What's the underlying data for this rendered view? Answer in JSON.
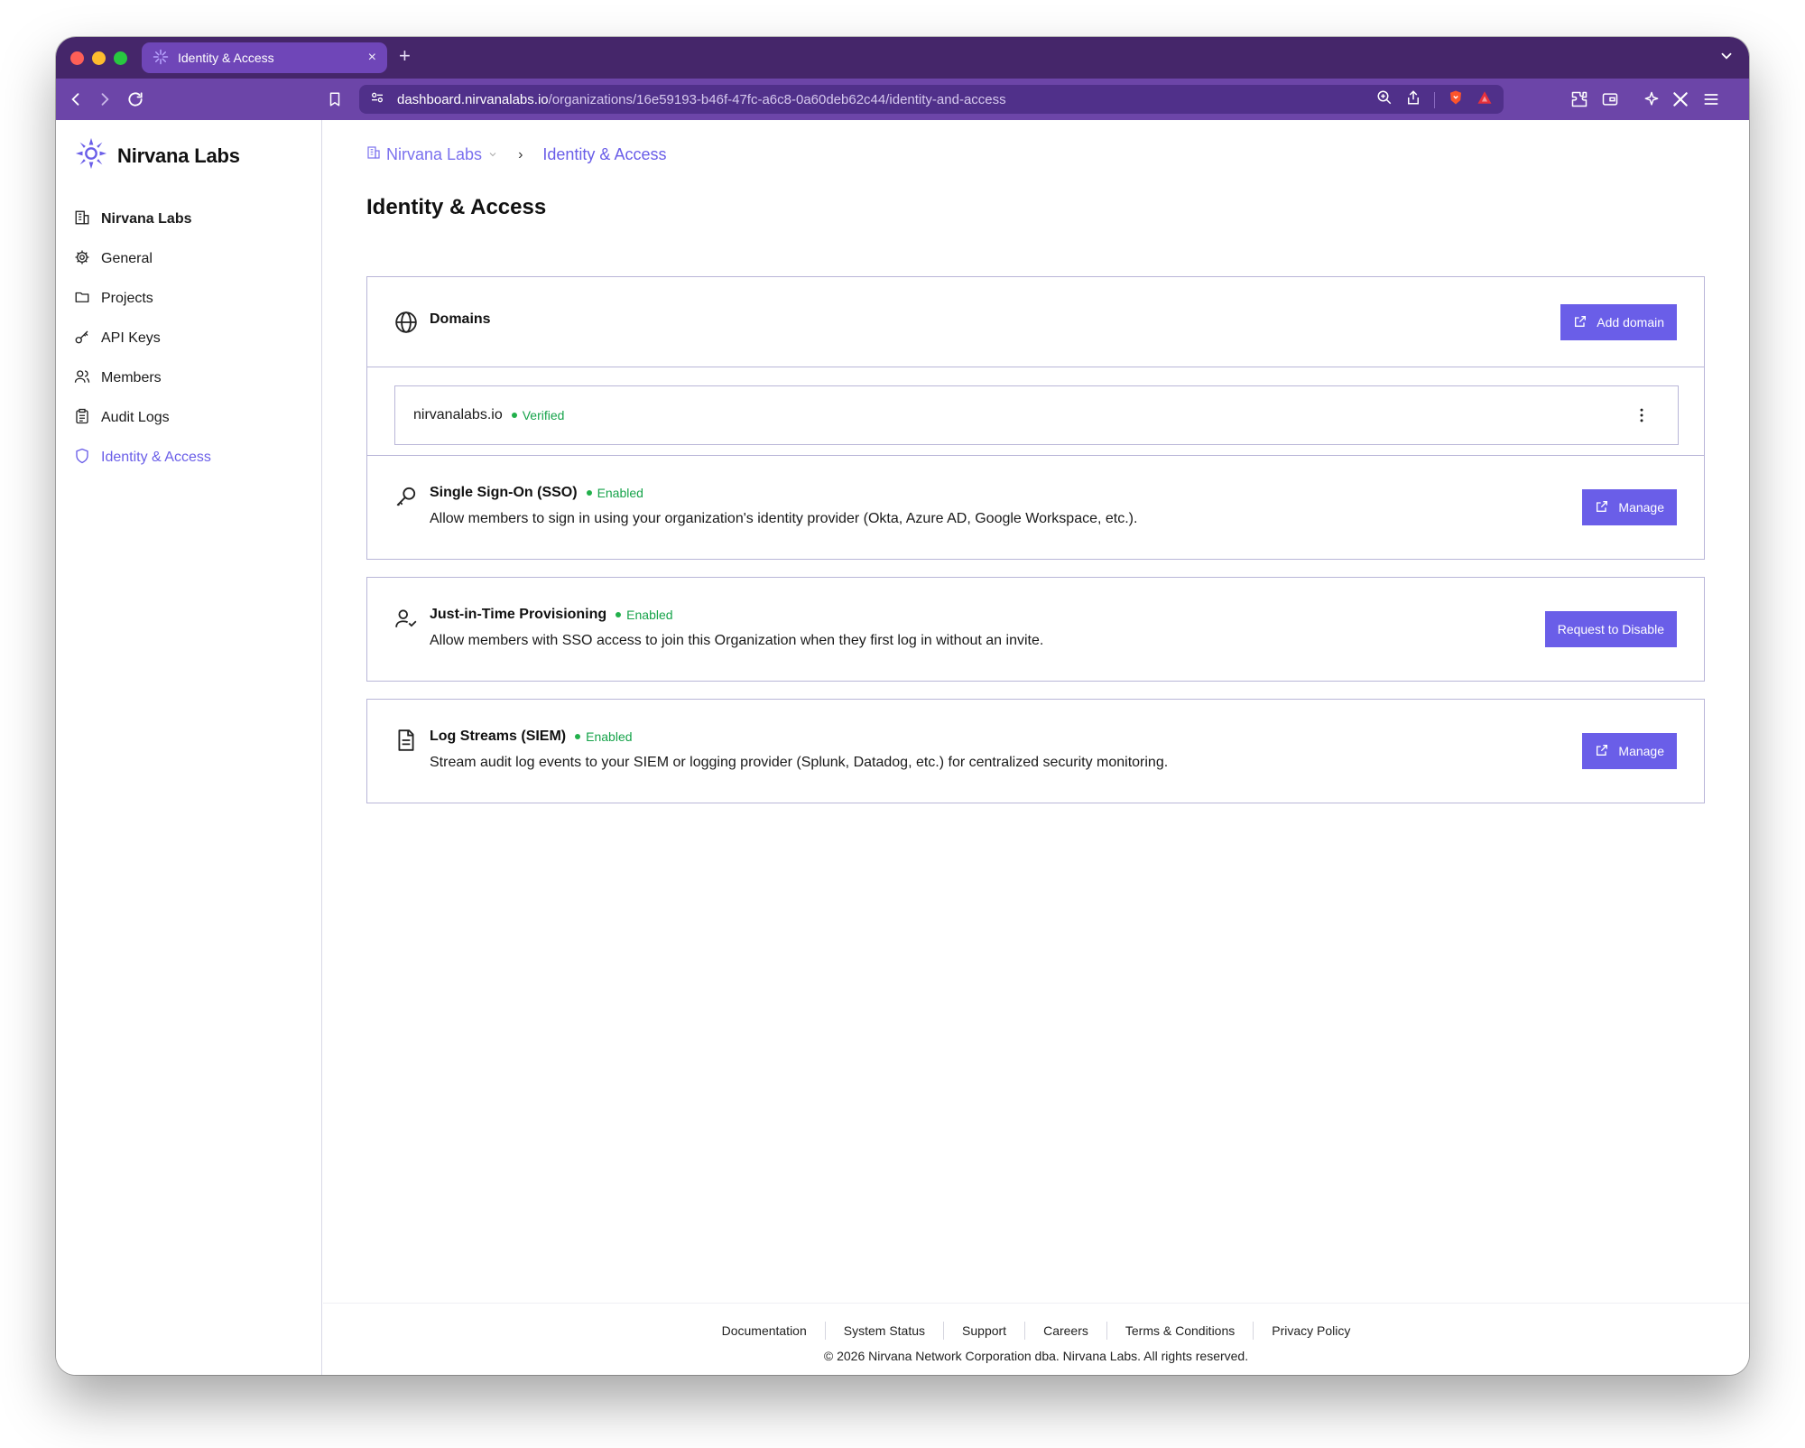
{
  "browser": {
    "tab_title": "Identity & Access",
    "tab_close": "×",
    "new_tab": "+",
    "url_host": "dashboard.nirvanalabs.io",
    "url_path": "/organizations/16e59193-b46f-47fc-a6c8-0a60deb62c44/identity-and-access",
    "colors": {
      "tabbar": "#45266a",
      "toolbar": "#6c45a8",
      "active_tab": "#6f46b8"
    }
  },
  "sidebar": {
    "brand": "Nirvana Labs",
    "items": [
      {
        "label": "Nirvana Labs",
        "icon": "building-icon",
        "bold": true
      },
      {
        "label": "General",
        "icon": "gear-icon"
      },
      {
        "label": "Projects",
        "icon": "folder-icon"
      },
      {
        "label": "API Keys",
        "icon": "key-icon"
      },
      {
        "label": "Members",
        "icon": "users-icon"
      },
      {
        "label": "Audit Logs",
        "icon": "clipboard-icon"
      },
      {
        "label": "Identity & Access",
        "icon": "shield-icon",
        "active": true
      }
    ]
  },
  "breadcrumb": {
    "org": "Nirvana Labs",
    "separator": "›",
    "current": "Identity & Access"
  },
  "page": {
    "title": "Identity & Access"
  },
  "domains": {
    "title": "Domains",
    "add_button": "Add domain",
    "rows": [
      {
        "name": "nirvanalabs.io",
        "status": "Verified"
      }
    ]
  },
  "sso": {
    "title": "Single Sign-On (SSO)",
    "status": "Enabled",
    "description": "Allow members to sign in using your organization's identity provider (Okta, Azure AD, Google Workspace, etc.).",
    "button": "Manage"
  },
  "jit": {
    "title": "Just-in-Time Provisioning",
    "status": "Enabled",
    "description": "Allow members with SSO access to join this Organization when they first log in without an invite.",
    "button": "Request to Disable"
  },
  "log_streams": {
    "title": "Log Streams (SIEM)",
    "status": "Enabled",
    "description": "Stream audit log events to your SIEM or logging provider (Splunk, Datadog, etc.) for centralized security monitoring.",
    "button": "Manage"
  },
  "footer": {
    "links": [
      "Documentation",
      "System Status",
      "Support",
      "Careers",
      "Terms & Conditions",
      "Privacy Policy"
    ],
    "copyright": "© 2026 Nirvana Network Corporation dba. Nirvana Labs. All rights reserved."
  },
  "colors": {
    "accent": "#6a5ee8",
    "status_green": "#16a34a",
    "border": "#b9b6d8"
  }
}
